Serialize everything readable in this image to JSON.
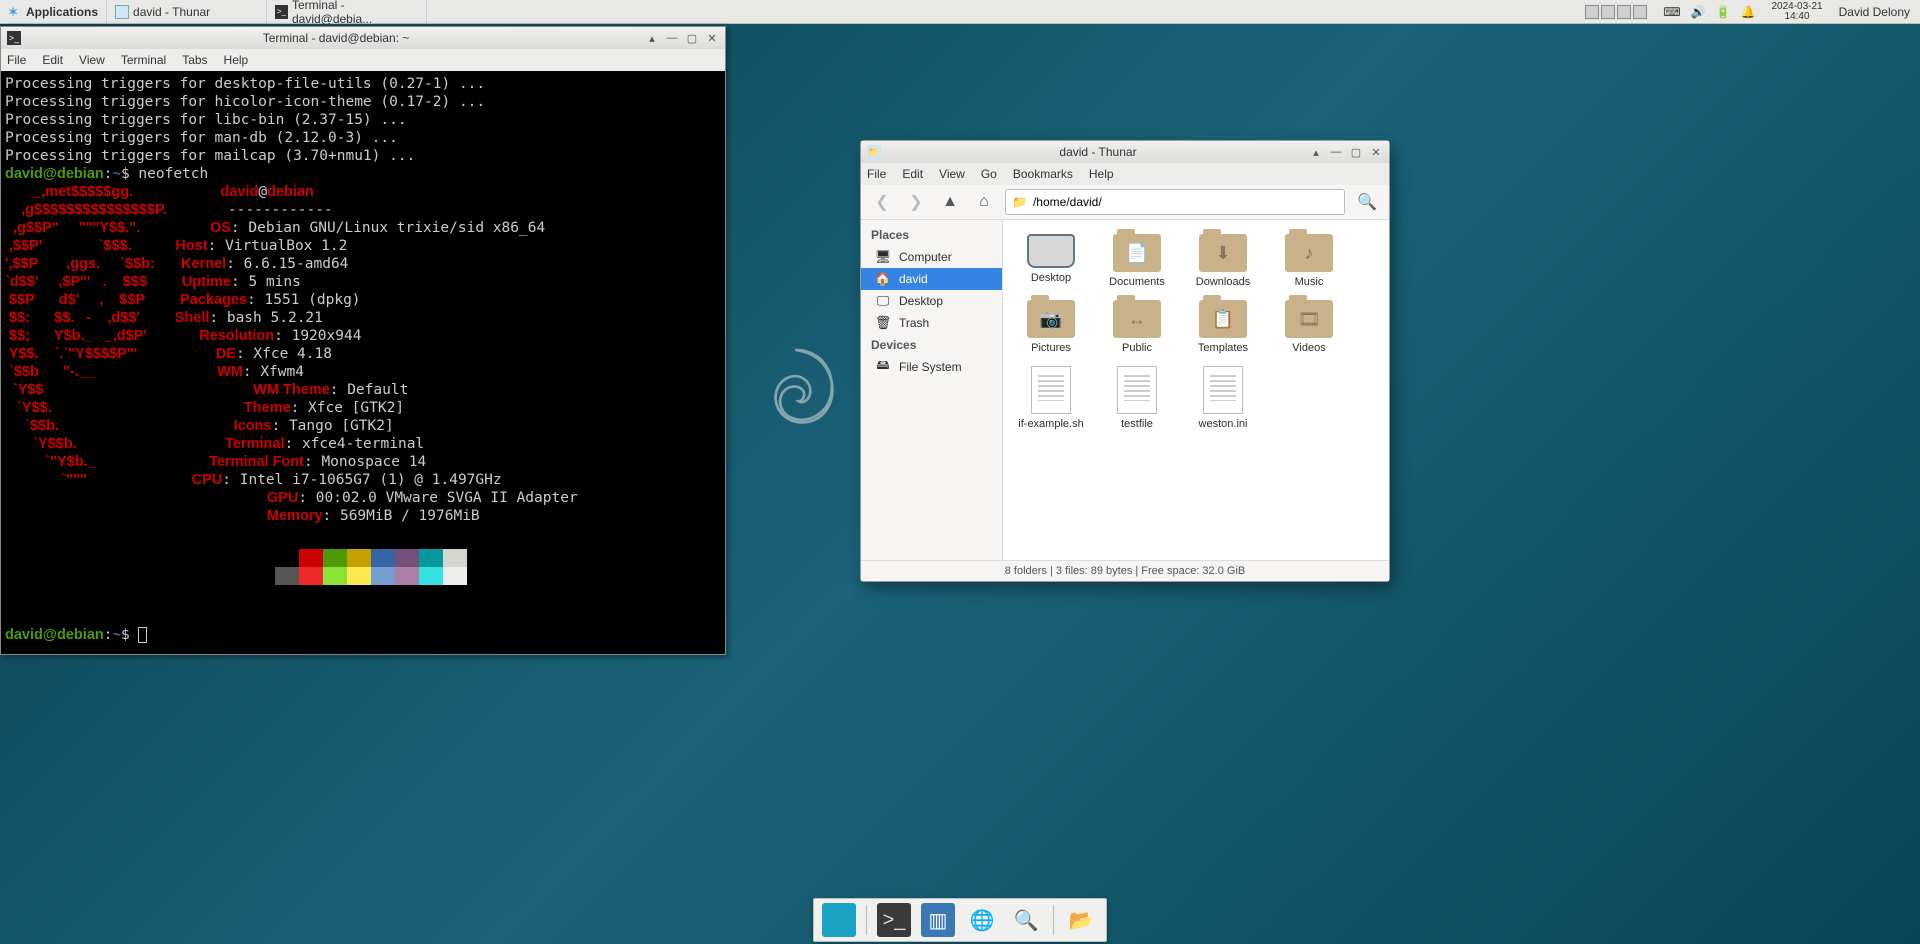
{
  "panel": {
    "applications_label": "Applications",
    "task_thunar": "david - Thunar",
    "task_terminal": "Terminal - david@debia...",
    "date": "2024-03-21",
    "time": "14:40",
    "user": "David Delony"
  },
  "terminal": {
    "title": "Terminal - david@debian: ~",
    "menus": [
      "File",
      "Edit",
      "View",
      "Terminal",
      "Tabs",
      "Help"
    ],
    "pre_lines": [
      "Processing triggers for desktop-file-utils (0.27-1) ...",
      "Processing triggers for hicolor-icon-theme (0.17-2) ...",
      "Processing triggers for libc-bin (2.37-15) ...",
      "Processing triggers for man-db (2.12.0-3) ...",
      "Processing triggers for mailcap (3.70+nmu1) ..."
    ],
    "prompt_user": "david@debian",
    "prompt_cwd": "~",
    "command": "neofetch",
    "ascii": [
      "       _,met$$$$$gg.",
      "    ,g$$$$$$$$$$$$$$$P.",
      "  ,g$$P\"     \"\"\"Y$$.\".",
      " ,$$P'              `$$$.",
      "',$$P       ,ggs.     `$$b:",
      "`d$$'     ,$P\"'   .    $$$",
      " $$P      d$'     ,    $$P",
      " $$:      $$.   -    ,d$$'",
      " $$;      Y$b._   _,d$P'",
      " Y$$.    `.`\"Y$$$$P\"'",
      " `$$b      \"-.__",
      "  `Y$$",
      "   `Y$$.",
      "     `$$b.",
      "       `Y$$b.",
      "          `\"Y$b._",
      "              `\"\"\""
    ],
    "info_header_user": "david",
    "info_header_host": "debian",
    "info_sep": "------------",
    "info": [
      {
        "k": "OS",
        "v": "Debian GNU/Linux trixie/sid x86_64"
      },
      {
        "k": "Host",
        "v": "VirtualBox 1.2"
      },
      {
        "k": "Kernel",
        "v": "6.6.15-amd64"
      },
      {
        "k": "Uptime",
        "v": "5 mins"
      },
      {
        "k": "Packages",
        "v": "1551 (dpkg)"
      },
      {
        "k": "Shell",
        "v": "bash 5.2.21"
      },
      {
        "k": "Resolution",
        "v": "1920x944"
      },
      {
        "k": "DE",
        "v": "Xfce 4.18"
      },
      {
        "k": "WM",
        "v": "Xfwm4"
      },
      {
        "k": "WM Theme",
        "v": "Default"
      },
      {
        "k": "Theme",
        "v": "Xfce [GTK2]"
      },
      {
        "k": "Icons",
        "v": "Tango [GTK2]"
      },
      {
        "k": "Terminal",
        "v": "xfce4-terminal"
      },
      {
        "k": "Terminal Font",
        "v": "Monospace 14"
      },
      {
        "k": "CPU",
        "v": "Intel i7-1065G7 (1) @ 1.497GHz"
      },
      {
        "k": "GPU",
        "v": "00:02.0 VMware SVGA II Adapter"
      },
      {
        "k": "Memory",
        "v": "569MiB / 1976MiB"
      }
    ],
    "palette_dark": [
      "#000000",
      "#cc0000",
      "#4e9a06",
      "#c4a000",
      "#3465a4",
      "#75507b",
      "#06989a",
      "#d3d7cf"
    ],
    "palette_light": [
      "#555753",
      "#ef2929",
      "#8ae234",
      "#fce94f",
      "#729fcf",
      "#ad7fa8",
      "#34e2e2",
      "#eeeeec"
    ]
  },
  "thunar": {
    "title": "david - Thunar",
    "menus": [
      "File",
      "Edit",
      "View",
      "Go",
      "Bookmarks",
      "Help"
    ],
    "path": "/home/david/",
    "places_label": "Places",
    "devices_label": "Devices",
    "places": [
      {
        "label": "Computer",
        "glyph": "🖥"
      },
      {
        "label": "david",
        "glyph": "🏠",
        "selected": true
      },
      {
        "label": "Desktop",
        "glyph": "🖵"
      },
      {
        "label": "Trash",
        "glyph": "🗑"
      }
    ],
    "devices": [
      {
        "label": "File System",
        "glyph": "🖴"
      }
    ],
    "items": [
      {
        "label": "Desktop",
        "type": "desktop"
      },
      {
        "label": "Documents",
        "type": "folder",
        "glyph": "📄"
      },
      {
        "label": "Downloads",
        "type": "folder",
        "glyph": "⬇"
      },
      {
        "label": "Music",
        "type": "folder",
        "glyph": "♪"
      },
      {
        "label": "Pictures",
        "type": "folder",
        "glyph": "📷"
      },
      {
        "label": "Public",
        "type": "folder",
        "glyph": "↔"
      },
      {
        "label": "Templates",
        "type": "folder",
        "glyph": "📋"
      },
      {
        "label": "Videos",
        "type": "folder",
        "glyph": "🎞"
      },
      {
        "label": "if-example.sh",
        "type": "file"
      },
      {
        "label": "testfile",
        "type": "file"
      },
      {
        "label": "weston.ini",
        "type": "file"
      }
    ],
    "status": "8 folders   |   3 files: 89 bytes   |   Free space: 32.0 GiB"
  }
}
